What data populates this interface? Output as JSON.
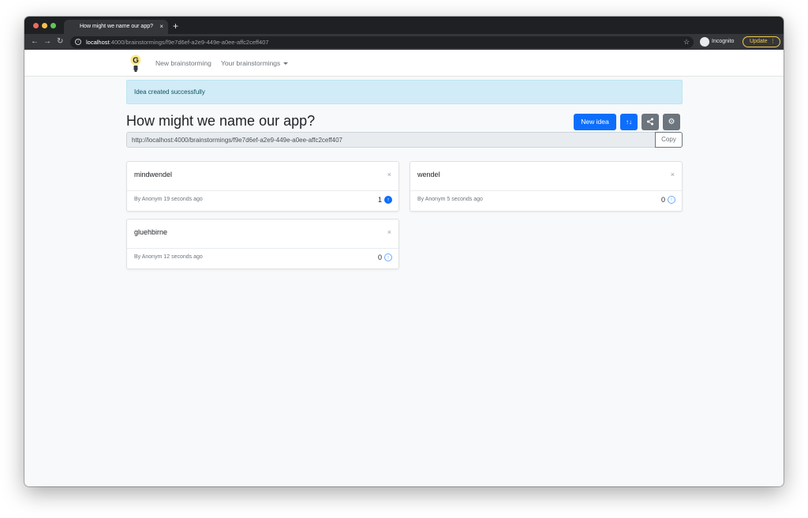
{
  "browser": {
    "tab_title": "How might we name our app?",
    "tab_close": "×",
    "new_tab": "+",
    "url_host": "localhost",
    "url_rest": ":4000/brainstormings/f9e7d6ef-a2e9-449e-a0ee-affc2ceff407",
    "profile_label": "Incognito",
    "update_label": "Update"
  },
  "navbar": {
    "logo_letter": "G",
    "new_brainstorming": "New brainstorming",
    "your_brainstormings": "Your brainstormings"
  },
  "alert": {
    "message": "Idea created successfully"
  },
  "page": {
    "title": "How might we name our app?",
    "new_idea_label": "New idea",
    "share_url": "http://localhost:4000/brainstormings/f9e7d6ef-a2e9-449e-a0ee-affc2ceff407",
    "copy_label": "Copy"
  },
  "ideas": [
    {
      "title": "mindwendel",
      "meta": "By Anonym 19 seconds ago",
      "votes": "1",
      "voted": true
    },
    {
      "title": "wendel",
      "meta": "By Anonym 5 seconds ago",
      "votes": "0",
      "voted": false
    },
    {
      "title": "gluehbirne",
      "meta": "By Anonym 12 seconds ago",
      "votes": "0",
      "voted": false
    }
  ],
  "icons": {
    "back": "arrow-left-icon",
    "forward": "arrow-right-icon",
    "reload": "reload-icon",
    "bookmark": "star-icon",
    "sort": "sort-icon",
    "share": "share-icon",
    "settings": "gear-icon",
    "vote": "arrow-up-circle-icon",
    "close": "close-icon"
  },
  "colors": {
    "primary": "#0d6efd",
    "secondary": "#6c757d",
    "alert_bg": "#d1ecf7"
  }
}
